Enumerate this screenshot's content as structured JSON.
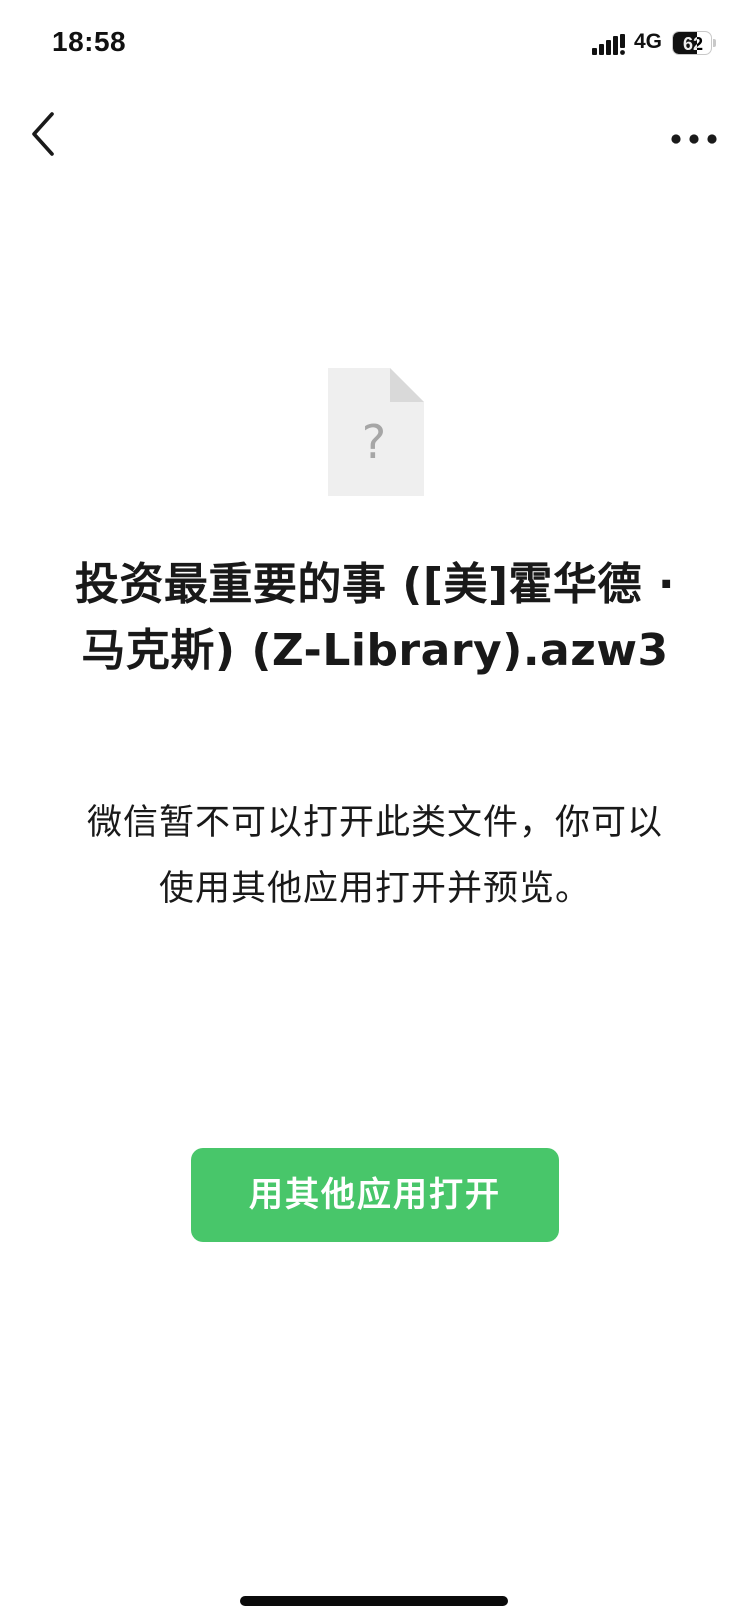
{
  "status_bar": {
    "time": "18:58",
    "network": "4G",
    "battery_level": "62",
    "battery_fraction": 0.62,
    "signal_icon": "cellular-signal-icon",
    "battery_icon": "battery-icon"
  },
  "nav": {
    "back_icon": "chevron-left-icon",
    "more_icon": "more-dots-icon"
  },
  "file": {
    "icon": "unknown-file-icon",
    "icon_glyph": "?",
    "name": "投资最重要的事 ([美]霍华德 · 马克斯) (Z-Library).azw3",
    "message": "微信暂不可以打开此类文件，你可以使用其他应用打开并预览。"
  },
  "actions": {
    "open_with_label": "用其他应用打开"
  },
  "colors": {
    "accent_green": "#48c66a",
    "text_primary": "#191919",
    "file_icon_gray": "#efefef"
  }
}
